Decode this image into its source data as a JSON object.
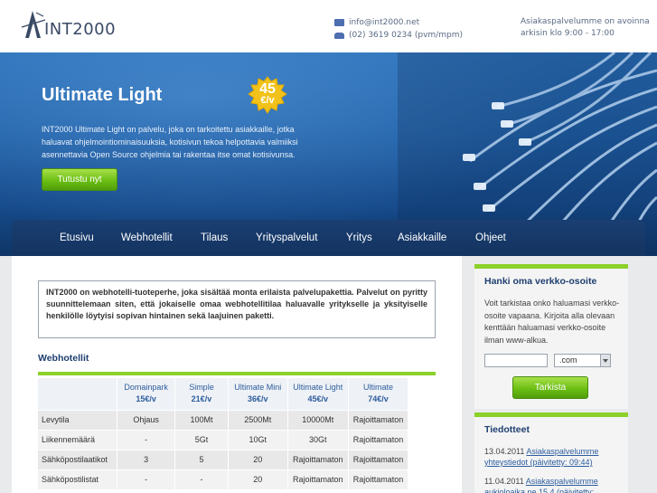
{
  "header": {
    "logo_text": "INT2000",
    "email": "info@int2000.net",
    "phone": "(02) 3619 0234 (pvm/mpm)",
    "hours_line1": "Asiakaspalvelumme on avoinna",
    "hours_line2": "arkisin klo 9:00 - 17:00"
  },
  "hero": {
    "title": "Ultimate Light",
    "badge_price": "45",
    "badge_unit": "€/v",
    "description": "INT2000 Ultimate Light on palvelu, joka on tarkoitettu asiakkaille, jotka haluavat ohjelmointiominaisuuksia, kotisivun tekoa helpottavia valmiiksi asennettavia Open Source ohjelmia tai rakentaa itse omat kotisivunsa.",
    "button_label": "Tutustu nyt"
  },
  "nav": {
    "items": [
      {
        "label": "Etusivu"
      },
      {
        "label": "Webhotellit"
      },
      {
        "label": "Tilaus"
      },
      {
        "label": "Yrityspalvelut"
      },
      {
        "label": "Yritys"
      },
      {
        "label": "Asiakkaille"
      },
      {
        "label": "Ohjeet"
      }
    ]
  },
  "main": {
    "intro": "INT2000 on webhotelli-tuoteperhe, joka sisältää monta erilaista palvelupakettia. Palvelut on pyritty suunnittelemaan siten, että jokaiselle omaa webhotellitilaa haluavalle yritykselle ja yksityiselle henkilölle löytyisi sopivan hintainen sekä laajuinen paketti.",
    "section_title": "Webhotellit",
    "plans": [
      {
        "name": "Domainpark",
        "price": "15€/v"
      },
      {
        "name": "Simple",
        "price": "21€/v"
      },
      {
        "name": "Ultimate Mini",
        "price": "36€/v"
      },
      {
        "name": "Ultimate Light",
        "price": "45€/v"
      },
      {
        "name": "Ultimate",
        "price": "74€/v"
      }
    ],
    "rows": [
      {
        "label": "Levytila",
        "values": [
          "Ohjaus",
          "100Mt",
          "2500Mt",
          "10000Mt",
          "Rajoittamaton"
        ]
      },
      {
        "label": "Liikennemäärä",
        "values": [
          "-",
          "5Gt",
          "10Gt",
          "30Gt",
          "Rajoittamaton"
        ]
      },
      {
        "label": "Sähköpostilaatikot",
        "values": [
          "3",
          "5",
          "20",
          "Rajoittamaton",
          "Rajoittamaton"
        ]
      },
      {
        "label": "Sähköpostilistat",
        "values": [
          "-",
          "-",
          "20",
          "Rajoittamaton",
          "Rajoittamaton"
        ]
      }
    ]
  },
  "sidebar": {
    "domain": {
      "title": "Hanki oma verkko-osoite",
      "text": "Voit tarkistaa onko haluamasi verkko-osoite vapaana. Kirjoita alla olevaan kenttään haluamasi verkko-osoite ilman www-alkua.",
      "tld_selected": ".com",
      "button_label": "Tarkista"
    },
    "news": {
      "title": "Tiedotteet",
      "items": [
        {
          "date": "13.04.2011",
          "text": "Asiakaspalvelumme yhteystiedot (päivitetty: 09:44)"
        },
        {
          "date": "11.04.2011",
          "text": "Asiakaspalvelumme aukioloaika pe 15.4 (päivitetty:"
        }
      ]
    }
  },
  "colors": {
    "accent_green": "#8cd02a",
    "nav_blue": "#1a3f72",
    "link_blue": "#2c5d9e"
  }
}
